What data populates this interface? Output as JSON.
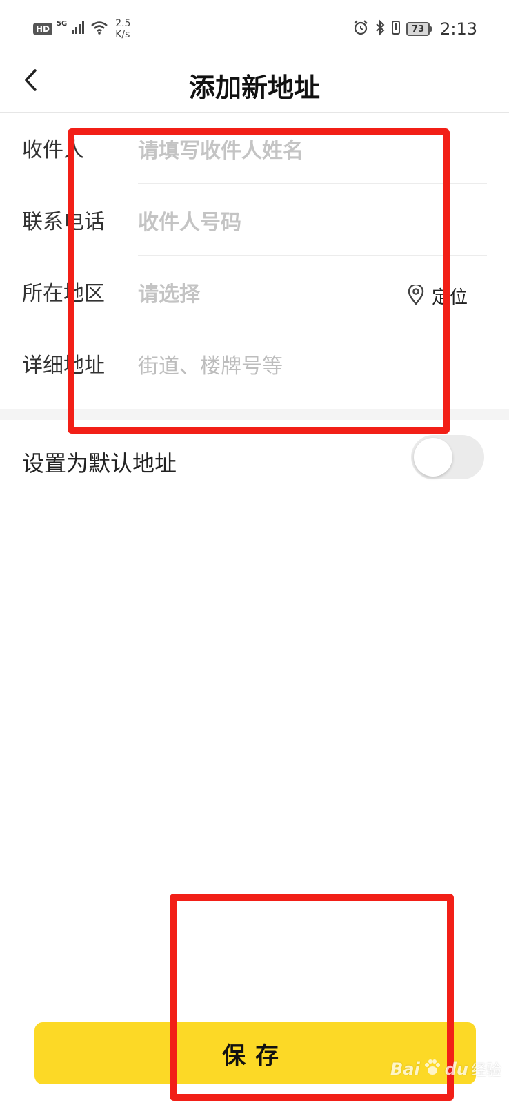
{
  "status_bar": {
    "hd": "HD",
    "signal": "5G",
    "net_speed_value": "2.5",
    "net_speed_unit": "K/s",
    "battery": "73",
    "time": "2:13",
    "icons": [
      "signal-icon",
      "wifi-icon",
      "alarm-icon",
      "bluetooth-icon",
      "vibrate-icon",
      "battery-icon"
    ]
  },
  "header": {
    "title": "添加新地址",
    "back_icon": "chevron-left-icon"
  },
  "form": {
    "rows": [
      {
        "label": "收件人",
        "placeholder": "请填写收件人姓名"
      },
      {
        "label": "联系电话",
        "placeholder": "收件人号码"
      },
      {
        "label": "所在地区",
        "placeholder": "请选择",
        "action_label": "定位",
        "action_icon": "location-pin-icon"
      },
      {
        "label": "详细地址",
        "placeholder": "街道、楼牌号等"
      }
    ]
  },
  "default_address": {
    "label": "设置为默认地址",
    "enabled": false
  },
  "save_button": {
    "label": "保存"
  },
  "colors": {
    "accent": "#fcd926",
    "annotation": "#f21f17",
    "placeholder": "#c4c4c4"
  },
  "watermark": {
    "brand": "Bai",
    "brand_mark": "du",
    "sub": "经验"
  }
}
